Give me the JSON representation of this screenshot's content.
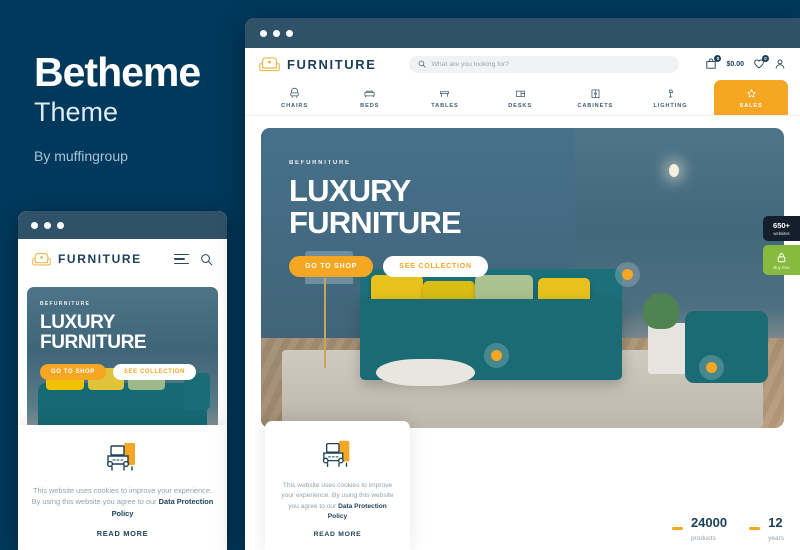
{
  "promo": {
    "title": "Betheme",
    "subtitle": "Theme",
    "author": "By muffingroup"
  },
  "colors": {
    "background": "#00395c",
    "accent_orange": "#f5a623",
    "brand_navy": "#1d4158",
    "chrome": "#2f5268",
    "badge_green": "#86bb40",
    "badge_dark": "#13202b",
    "logo_gold": "#e9b84a"
  },
  "desktop": {
    "brand": "FURNITURE",
    "search": {
      "placeholder": "What are you looking for?"
    },
    "header_icons": {
      "cart_badge": "0",
      "cart_total": "$0.00",
      "wishlist_badge": "0"
    },
    "nav": [
      {
        "label": "CHAIRS",
        "icon": "chair-icon"
      },
      {
        "label": "BEDS",
        "icon": "bed-icon"
      },
      {
        "label": "TABLES",
        "icon": "table-icon"
      },
      {
        "label": "DESKS",
        "icon": "desk-icon"
      },
      {
        "label": "CABINETS",
        "icon": "cabinet-icon"
      },
      {
        "label": "LIGHTING",
        "icon": "lamp-icon"
      },
      {
        "label": "SALES",
        "icon": "star-icon"
      }
    ],
    "hero": {
      "kicker": "BEFURNITURE",
      "line1": "LUXURY",
      "line2": "FURNITURE",
      "primary_button": "GO TO SHOP",
      "secondary_button": "SEE COLLECTION"
    },
    "side_badges": [
      {
        "number": "650+",
        "caption": "websites",
        "icon": "none"
      },
      {
        "number": "",
        "caption": "Buy now",
        "icon": "lock-icon"
      }
    ],
    "stats": [
      {
        "number": "24000",
        "caption": "products"
      },
      {
        "number": "12",
        "caption": "years"
      }
    ],
    "cookie": {
      "icon": "sofa-cookie-icon",
      "text_plain": "This website uses cookies to improve your experience. By using this website you agree to our ",
      "text_link": "Data Protection Policy",
      "read_more": "READ MORE"
    }
  },
  "mobile": {
    "brand": "FURNITURE",
    "icons": {
      "menu": "hamburger-icon",
      "search": "search-icon"
    },
    "hero": {
      "kicker": "BEFURNITURE",
      "line1": "LUXURY",
      "line2": "FURNITURE",
      "primary_button": "GO TO SHOP",
      "secondary_button": "SEE COLLECTION"
    },
    "cookie": {
      "icon": "sofa-cookie-icon",
      "text_plain": "This website uses cookies to improve your experience. By using this website you agree to our ",
      "text_link": "Data Protection Policy",
      "read_more": "READ MORE"
    }
  }
}
